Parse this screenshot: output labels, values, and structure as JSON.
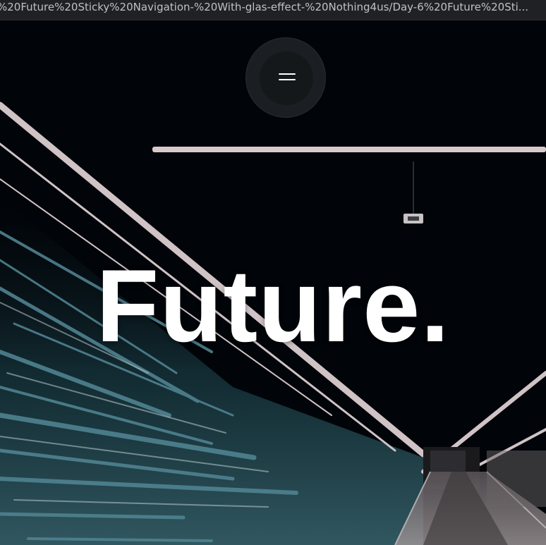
{
  "browser": {
    "url_text": "%20Future%20Sticky%20Navigation-%20With-glas-effect-%20Nothing4us/Day-6%20Future%20Sti..."
  },
  "nav": {
    "menu_icon": "hamburger-menu-icon"
  },
  "hero": {
    "headline": "Future."
  },
  "colors": {
    "background": "#02060a",
    "light_streak": "#cfc3c6",
    "teal_streak": "#3f6f7a",
    "text": "#ffffff"
  }
}
